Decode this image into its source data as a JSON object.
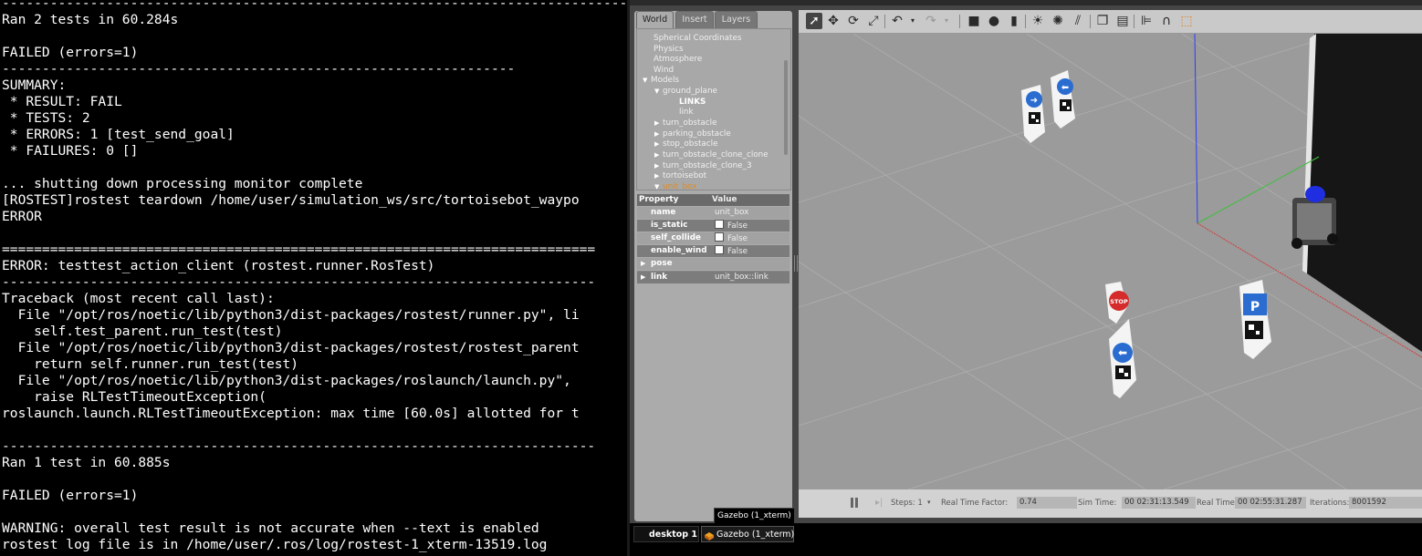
{
  "terminal": {
    "lines": [
      "-----------------------------------------------------------------------------------",
      "Ran 2 tests in 60.284s",
      "",
      "FAILED (errors=1)",
      "----------------------------------------------------------------",
      "SUMMARY:",
      " * RESULT: FAIL",
      " * TESTS: 2",
      " * ERRORS: 1 [test_send_goal]",
      " * FAILURES: 0 []",
      "",
      "... shutting down processing monitor complete",
      "[ROSTEST]rostest teardown /home/user/simulation_ws/src/tortoisebot_waypo",
      "ERROR",
      "",
      "==========================================================================",
      "ERROR: testtest_action_client (rostest.runner.RosTest)",
      "--------------------------------------------------------------------------",
      "Traceback (most recent call last):",
      "  File \"/opt/ros/noetic/lib/python3/dist-packages/rostest/runner.py\", li",
      "    self.test_parent.run_test(test)",
      "  File \"/opt/ros/noetic/lib/python3/dist-packages/rostest/rostest_parent",
      "    return self.runner.run_test(test)",
      "  File \"/opt/ros/noetic/lib/python3/dist-packages/roslaunch/launch.py\",",
      "    raise RLTestTimeoutException(",
      "roslaunch.launch.RLTestTimeoutException: max time [60.0s] allotted for t",
      "",
      "--------------------------------------------------------------------------",
      "Ran 1 test in 60.885s",
      "",
      "FAILED (errors=1)",
      "",
      "WARNING: overall test result is not accurate when --text is enabled",
      "rostest log file is in /home/user/.ros/log/rostest-1_xterm-13519.log"
    ]
  },
  "gazebo": {
    "tabs": {
      "world": "World",
      "insert": "Insert",
      "layers": "Layers"
    },
    "tree": {
      "spherical": "Spherical Coordinates",
      "physics": "Physics",
      "atmosphere": "Atmosphere",
      "wind": "Wind",
      "models": "Models",
      "ground_plane": "ground_plane",
      "links": "LINKS",
      "link": "link",
      "turn_obstacle": "turn_obstacle",
      "parking_obstacle": "parking_obstacle",
      "stop_obstacle": "stop_obstacle",
      "turn_clone_clone": "turn_obstacle_clone_clone",
      "turn_clone_3": "turn_obstacle_clone_3",
      "tortoisebot": "tortoisebot",
      "unit_box": "unit_box",
      "selected_color": "#e08a1e"
    },
    "properties": {
      "header_property": "Property",
      "header_value": "Value",
      "name_key": "name",
      "name_value": "unit_box",
      "is_static_key": "is_static",
      "is_static_value": "False",
      "self_collide_key": "self_collide",
      "self_collide_value": "False",
      "enable_wind_key": "enable_wind",
      "enable_wind_value": "False",
      "pose_key": "pose",
      "link_key": "link",
      "link_value": "unit_box::link"
    },
    "toolbar_icons": [
      "select-arrow-icon",
      "translate-icon",
      "rotate-icon",
      "scale-icon",
      "undo-icon",
      "undo-dropdown-icon",
      "redo-icon",
      "redo-dropdown-icon",
      "box-shape-icon",
      "sphere-shape-icon",
      "cylinder-shape-icon",
      "point-light-icon",
      "spot-light-icon",
      "directional-light-icon",
      "copy-icon",
      "paste-icon",
      "align-icon",
      "snap-icon",
      "change-view-icon"
    ],
    "bottom": {
      "steps_label": "Steps: 1",
      "rtf_label": "Real Time Factor:",
      "rtf_value": "0.74",
      "sim_label": "Sim Time:",
      "sim_value": "00 02:31:13.549",
      "real_label": "Real Time:",
      "real_value": "00 02:55:31.287",
      "iter_label": "Iterations:",
      "iter_value": "8001592"
    },
    "viewport_signs": {
      "stop_text": "STOP",
      "parking_text": "P"
    }
  },
  "taskbar": {
    "tooltip": "Gazebo (1_xterm)",
    "desktop": "desktop 1",
    "gazebo_task": "Gazebo (1_xterm)"
  }
}
